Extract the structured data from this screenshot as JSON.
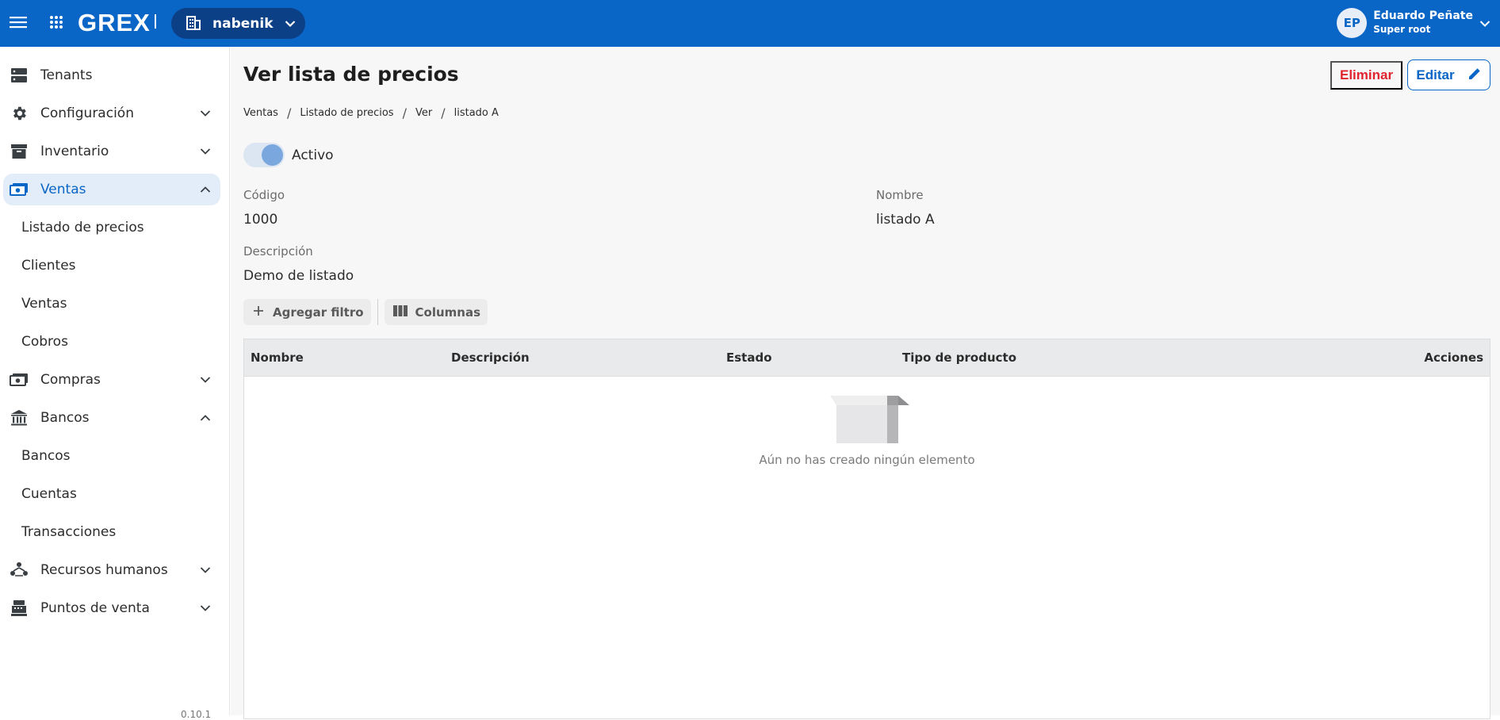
{
  "app": {
    "logo": "GREX",
    "tenant": "nabenik",
    "user": {
      "initials": "EP",
      "name": "Eduardo Peñate",
      "role": "Super root"
    }
  },
  "sidebar": {
    "items": [
      {
        "label": "Tenants",
        "icon": "server-icon"
      },
      {
        "label": "Configuración",
        "icon": "gear-icon",
        "expand": "down"
      },
      {
        "label": "Inventario",
        "icon": "archive-icon",
        "expand": "down"
      },
      {
        "label": "Ventas",
        "icon": "cash-icon",
        "expand": "up",
        "active": true
      },
      {
        "label": "Listado de precios",
        "sub": true
      },
      {
        "label": "Clientes",
        "sub": true
      },
      {
        "label": "Ventas",
        "sub": true
      },
      {
        "label": "Cobros",
        "sub": true
      },
      {
        "label": "Compras",
        "icon": "cash-icon",
        "expand": "down"
      },
      {
        "label": "Bancos",
        "icon": "bank-icon",
        "expand": "up"
      },
      {
        "label": "Bancos",
        "sub": true
      },
      {
        "label": "Cuentas",
        "sub": true
      },
      {
        "label": "Transacciones",
        "sub": true
      },
      {
        "label": "Recursos humanos",
        "icon": "people-icon",
        "expand": "down"
      },
      {
        "label": "Puntos de venta",
        "icon": "register-icon",
        "expand": "down"
      }
    ],
    "version": "0.10.1"
  },
  "page": {
    "title": "Ver lista de precios",
    "delete_label": "Eliminar",
    "edit_label": "Editar",
    "breadcrumb": [
      "Ventas",
      "Listado de precios",
      "Ver",
      "listado A"
    ],
    "active_label": "Activo",
    "active": true,
    "fields": {
      "code_label": "Código",
      "code_value": "1000",
      "name_label": "Nombre",
      "name_value": "listado A",
      "desc_label": "Descripción",
      "desc_value": "Demo de listado"
    },
    "add_filter_label": "Agregar filtro",
    "columns_label": "Columnas",
    "table": {
      "headers": [
        "Nombre",
        "Descripción",
        "Estado",
        "Tipo de producto",
        "Acciones"
      ],
      "empty_text": "Aún no has creado ningún elemento"
    }
  },
  "colors": {
    "primary": "#0a66c6",
    "danger": "#e0242f",
    "tenant_pill": "#0b3f86"
  }
}
